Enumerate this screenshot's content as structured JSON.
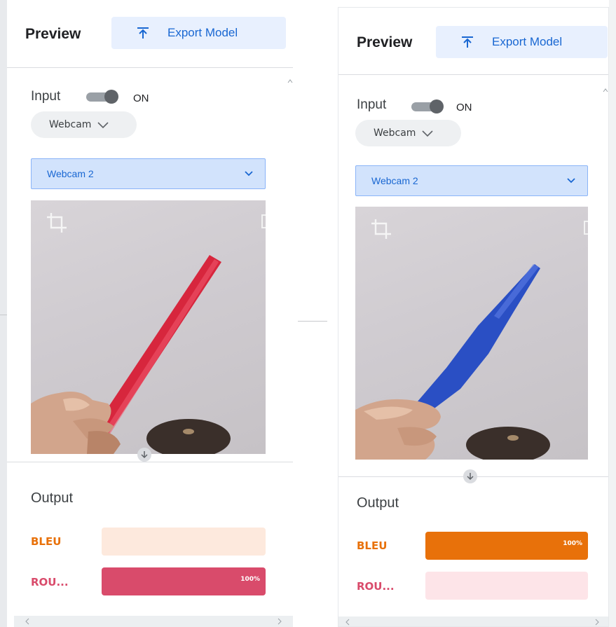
{
  "panels": [
    {
      "preview_title": "Preview",
      "export_label": "Export Model",
      "input_label": "Input",
      "toggle_state": "ON",
      "source_label": "Webcam",
      "camera_select": "Webcam 2",
      "output_label": "Output",
      "classes": [
        {
          "label": "BLEU",
          "confidence": 0,
          "percent_text": "",
          "color": "#e8710a"
        },
        {
          "label": "ROU...",
          "confidence": 1.0,
          "percent_text": "100%",
          "color": "#d94b6b"
        }
      ],
      "pen_color": "#d7263d"
    },
    {
      "preview_title": "Preview",
      "export_label": "Export Model",
      "input_label": "Input",
      "toggle_state": "ON",
      "source_label": "Webcam",
      "camera_select": "Webcam 2",
      "output_label": "Output",
      "classes": [
        {
          "label": "BLEU",
          "confidence": 1.0,
          "percent_text": "100%",
          "color": "#e8710a"
        },
        {
          "label": "ROU...",
          "confidence": 0,
          "percent_text": "",
          "color": "#d94b6b"
        }
      ],
      "pen_color": "#2a4fc4"
    }
  ],
  "colors": {
    "accent_blue": "#1967d2",
    "bleu_track": "#fde9dd",
    "rouge_track": "#fde4e8"
  }
}
